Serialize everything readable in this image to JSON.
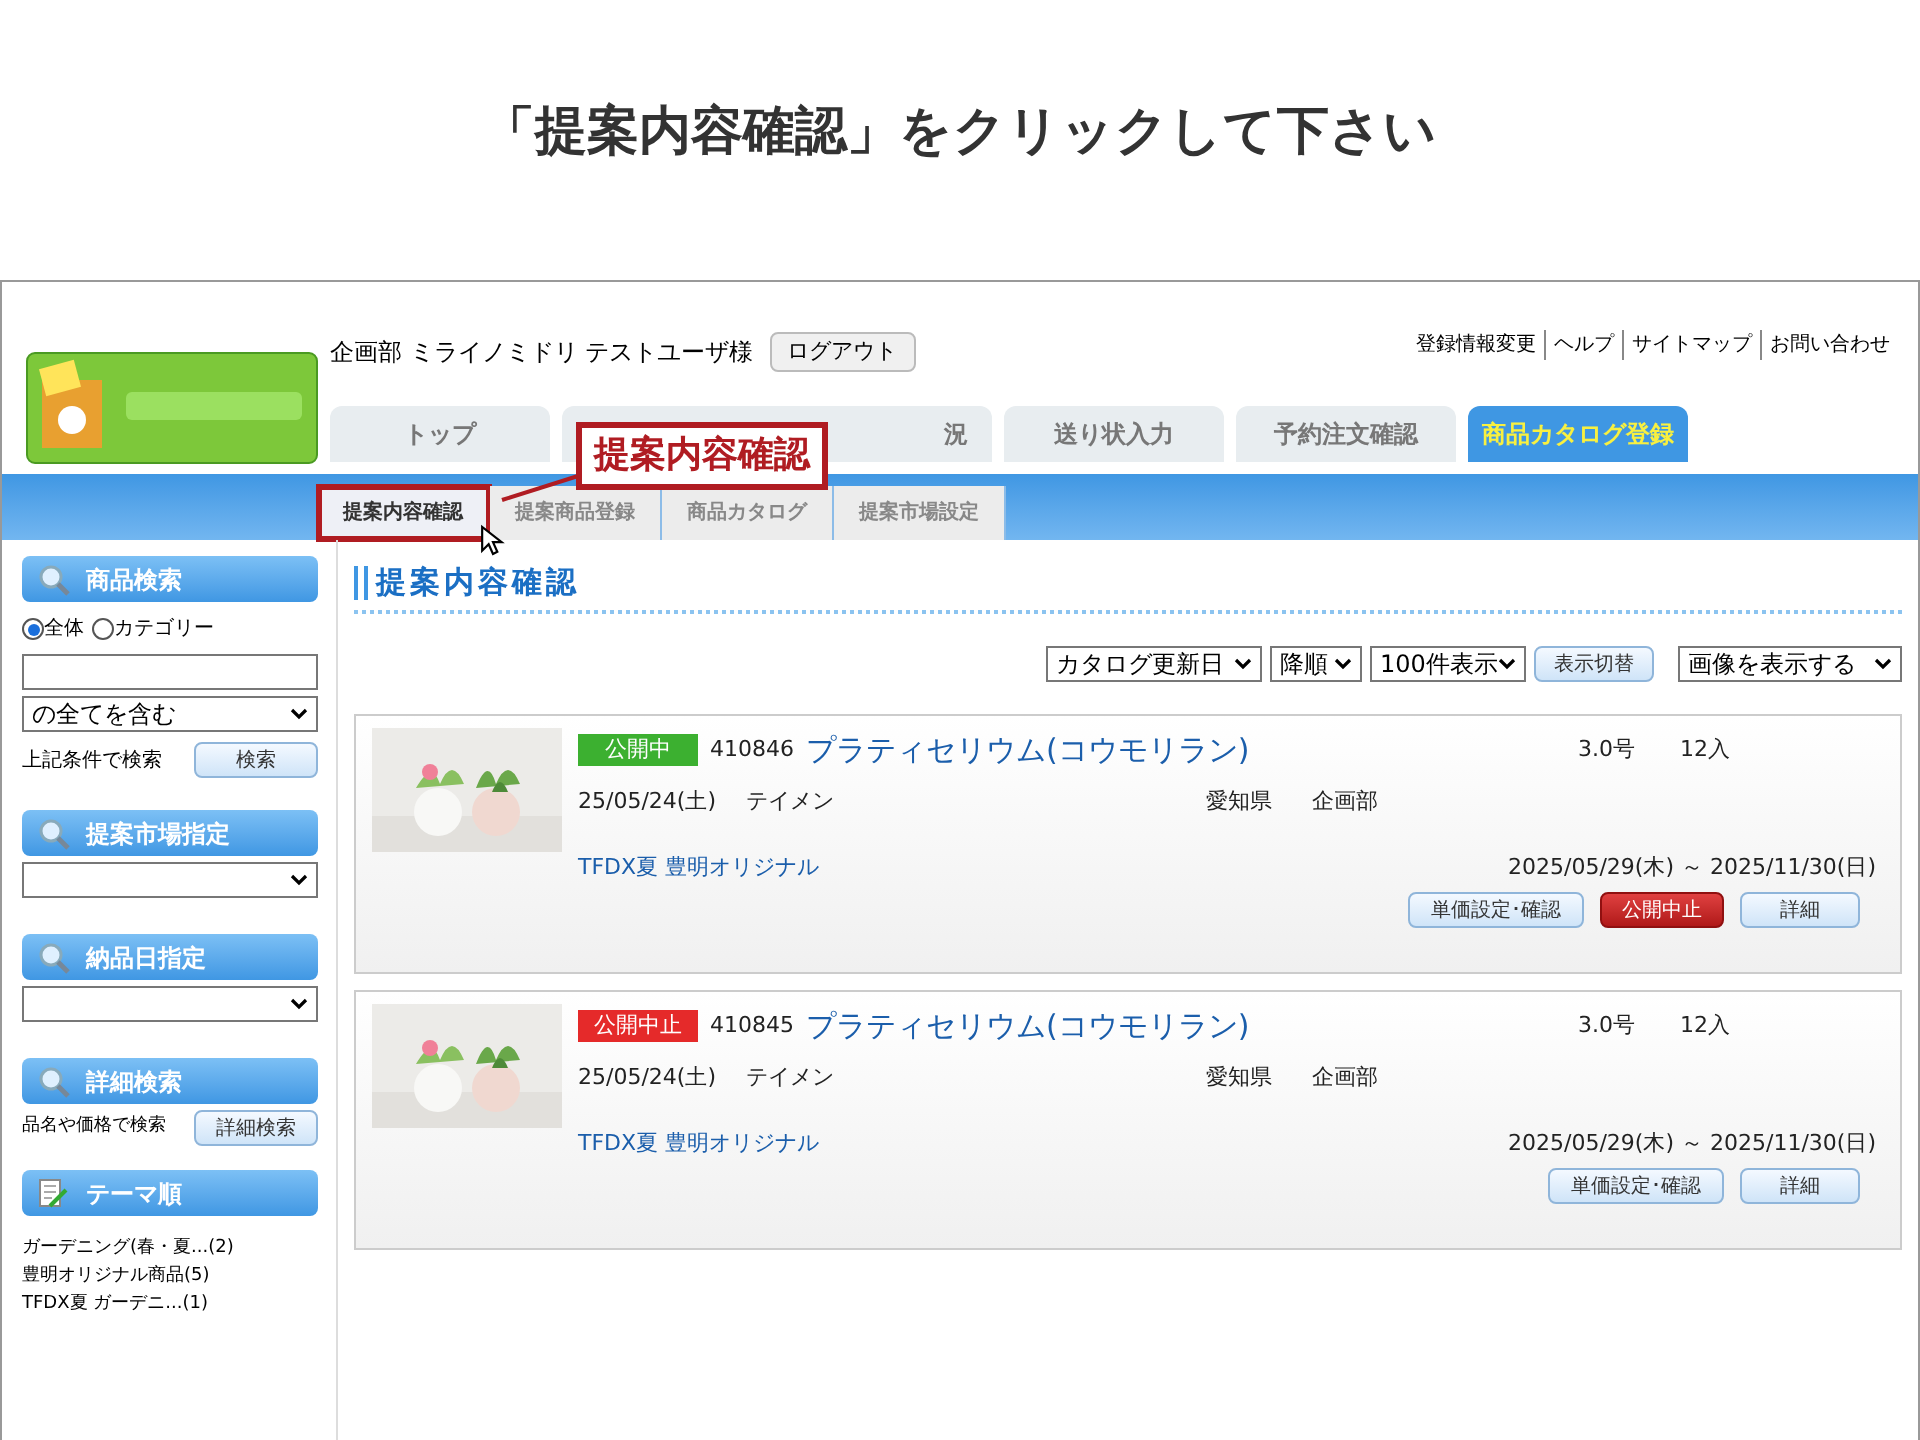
{
  "slide_title": "「提案内容確認」をクリックして下さい",
  "header": {
    "user": "企画部 ミライノミドリ テストユーザ様",
    "logout": "ログアウト",
    "links": [
      "登録情報変更",
      "ヘルプ",
      "サイトマップ",
      "お問い合わせ"
    ]
  },
  "tabs": [
    {
      "label": "トップ",
      "selected": false
    },
    {
      "label": "況",
      "selected": false
    },
    {
      "label": "送り状入力",
      "selected": false
    },
    {
      "label": "予約注文確認",
      "selected": false
    },
    {
      "label": "商品カタログ登録",
      "selected": true
    }
  ],
  "subtabs": [
    {
      "label": "提案内容確認",
      "selected": true
    },
    {
      "label": "提案商品登録",
      "selected": false
    },
    {
      "label": "商品カタログ",
      "selected": false
    },
    {
      "label": "提案市場設定",
      "selected": false
    }
  ],
  "callout": "提案内容確認",
  "sidebar": {
    "search": {
      "title": "商品検索",
      "radios": [
        {
          "label": "全体",
          "selected": true
        },
        {
          "label": "カテゴリー",
          "selected": false
        }
      ],
      "match": "の全てを含む",
      "hint": "上記条件で検索",
      "button": "検索"
    },
    "market": {
      "title": "提案市場指定"
    },
    "delivery": {
      "title": "納品日指定"
    },
    "advanced": {
      "title": "詳細検索",
      "hint": "品名や価格で検索",
      "button": "詳細検索"
    },
    "theme": {
      "title": "テーマ順",
      "items": [
        "ガーデニング(春・夏...(2)",
        "豊明オリジナル商品(5)",
        "TFDX夏 ガーデニ...(1)"
      ]
    }
  },
  "main": {
    "title": "提案内容確認",
    "toolbar": {
      "sort": "カタログ更新日",
      "order": "降順",
      "count": "100件表示",
      "toggle": "表示切替",
      "image": "画像を表示する"
    },
    "products": [
      {
        "status": "公開中",
        "kind": "published",
        "code": "410846",
        "name": "プラティセリウム(コウモリラン)",
        "size": "3.0号",
        "qty": "12入",
        "date": "25/05/24(土)",
        "grower": "テイメン",
        "pref": "愛知県",
        "dept": "企画部",
        "tags": "TFDX夏 豊明オリジナル",
        "period": "2025/05/29(木) ～ 2025/11/30(日)",
        "buttons": [
          {
            "label": "単価設定･確認",
            "kind": "normal"
          },
          {
            "label": "公開中止",
            "kind": "danger"
          },
          {
            "label": "詳細",
            "kind": "normal"
          }
        ]
      },
      {
        "status": "公開中止",
        "kind": "stopped",
        "code": "410845",
        "name": "プラティセリウム(コウモリラン)",
        "size": "3.0号",
        "qty": "12入",
        "date": "25/05/24(土)",
        "grower": "テイメン",
        "pref": "愛知県",
        "dept": "企画部",
        "tags": "TFDX夏 豊明オリジナル",
        "period": "2025/05/29(木) ～ 2025/11/30(日)",
        "buttons": [
          {
            "label": "単価設定･確認",
            "kind": "normal"
          },
          {
            "label": "詳細",
            "kind": "normal"
          }
        ]
      }
    ]
  }
}
